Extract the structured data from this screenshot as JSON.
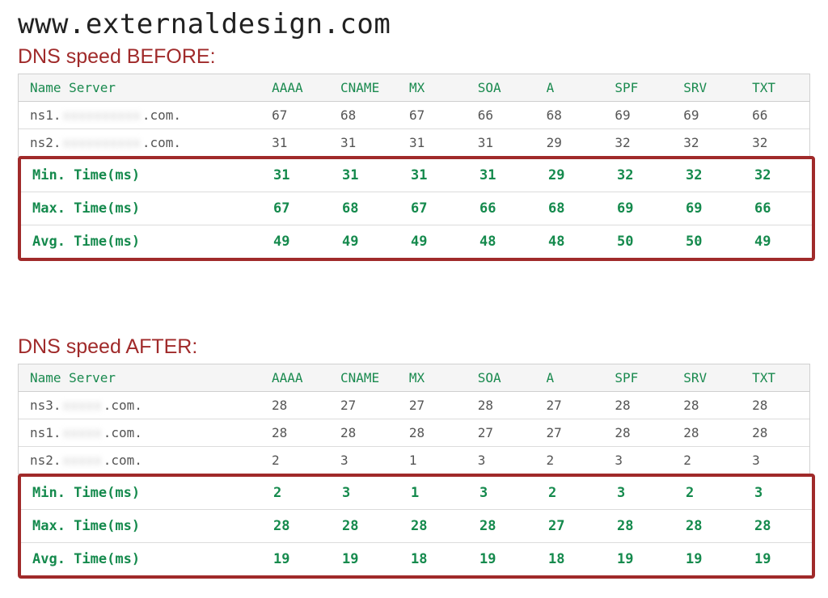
{
  "site_title": "www.externaldesign.com",
  "headings": {
    "before": "DNS speed BEFORE:",
    "after": "DNS speed AFTER:"
  },
  "columns": [
    "Name Server",
    "AAAA",
    "CNAME",
    "MX",
    "SOA",
    "A",
    "SPF",
    "SRV",
    "TXT"
  ],
  "before": {
    "servers": [
      {
        "prefix": "ns1.",
        "hidden": "xxxxxxxxxx",
        "suffix": ".com.",
        "values": [
          67,
          68,
          67,
          66,
          68,
          69,
          69,
          66
        ]
      },
      {
        "prefix": "ns2.",
        "hidden": "xxxxxxxxxx",
        "suffix": ".com.",
        "values": [
          31,
          31,
          31,
          31,
          29,
          32,
          32,
          32
        ]
      }
    ],
    "stats": [
      {
        "label": "Min. Time(ms)",
        "values": [
          31,
          31,
          31,
          31,
          29,
          32,
          32,
          32
        ]
      },
      {
        "label": "Max. Time(ms)",
        "values": [
          67,
          68,
          67,
          66,
          68,
          69,
          69,
          66
        ]
      },
      {
        "label": "Avg. Time(ms)",
        "values": [
          49,
          49,
          49,
          48,
          48,
          50,
          50,
          49
        ]
      }
    ]
  },
  "after": {
    "servers": [
      {
        "prefix": "ns3.",
        "hidden": "xxxxx",
        "suffix": ".com.",
        "values": [
          28,
          27,
          27,
          28,
          27,
          28,
          28,
          28
        ]
      },
      {
        "prefix": "ns1.",
        "hidden": "xxxxx",
        "suffix": ".com.",
        "values": [
          28,
          28,
          28,
          27,
          27,
          28,
          28,
          28
        ]
      },
      {
        "prefix": "ns2.",
        "hidden": "xxxxx",
        "suffix": ".com.",
        "values": [
          2,
          3,
          1,
          3,
          2,
          3,
          2,
          3
        ]
      }
    ],
    "stats": [
      {
        "label": "Min. Time(ms)",
        "values": [
          2,
          3,
          1,
          3,
          2,
          3,
          2,
          3
        ]
      },
      {
        "label": "Max. Time(ms)",
        "values": [
          28,
          28,
          28,
          28,
          27,
          28,
          28,
          28
        ]
      },
      {
        "label": "Avg. Time(ms)",
        "values": [
          19,
          19,
          18,
          19,
          18,
          19,
          19,
          19
        ]
      }
    ]
  },
  "chart_data": {
    "type": "table",
    "title": "DNS lookup speed comparison for www.externaldesign.com (ms)",
    "record_types": [
      "AAAA",
      "CNAME",
      "MX",
      "SOA",
      "A",
      "SPF",
      "SRV",
      "TXT"
    ],
    "before": {
      "min": [
        31,
        31,
        31,
        31,
        29,
        32,
        32,
        32
      ],
      "max": [
        67,
        68,
        67,
        66,
        68,
        69,
        69,
        66
      ],
      "avg": [
        49,
        49,
        49,
        48,
        48,
        50,
        50,
        49
      ]
    },
    "after": {
      "min": [
        2,
        3,
        1,
        3,
        2,
        3,
        2,
        3
      ],
      "max": [
        28,
        28,
        28,
        28,
        27,
        28,
        28,
        28
      ],
      "avg": [
        19,
        19,
        18,
        19,
        18,
        19,
        19,
        19
      ]
    }
  }
}
